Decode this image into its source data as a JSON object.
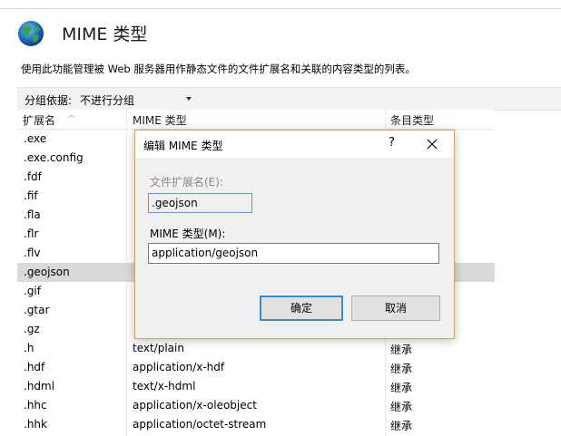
{
  "header": {
    "title": "MIME 类型",
    "description": "使用此功能管理被 Web 服务器用作静态文件的文件扩展名和关联的内容类型的列表。"
  },
  "group_bar": {
    "label": "分组依据:",
    "selected": "不进行分组"
  },
  "table": {
    "columns": [
      "扩展名",
      "MIME 类型",
      "条目类型"
    ],
    "rows": [
      {
        "ext": ".exe",
        "mime": "",
        "type": ""
      },
      {
        "ext": ".exe.config",
        "mime": "",
        "type": ""
      },
      {
        "ext": ".fdf",
        "mime": "",
        "type": ""
      },
      {
        "ext": ".fif",
        "mime": "",
        "type": ""
      },
      {
        "ext": ".fla",
        "mime": "",
        "type": ""
      },
      {
        "ext": ".flr",
        "mime": "",
        "type": ""
      },
      {
        "ext": ".flv",
        "mime": "",
        "type": ""
      },
      {
        "ext": ".geojson",
        "mime": "",
        "type": ""
      },
      {
        "ext": ".gif",
        "mime": "",
        "type": ""
      },
      {
        "ext": ".gtar",
        "mime": "",
        "type": ""
      },
      {
        "ext": ".gz",
        "mime": "",
        "type": ""
      },
      {
        "ext": ".h",
        "mime": "text/plain",
        "type": "继承"
      },
      {
        "ext": ".hdf",
        "mime": "application/x-hdf",
        "type": "继承"
      },
      {
        "ext": ".hdml",
        "mime": "text/x-hdml",
        "type": "继承"
      },
      {
        "ext": ".hhc",
        "mime": "application/x-oleobject",
        "type": "继承"
      },
      {
        "ext": ".hhk",
        "mime": "application/octet-stream",
        "type": "继承"
      }
    ]
  },
  "dialog": {
    "title": "编辑 MIME 类型",
    "help": "?",
    "ext_label": "文件扩展名(E):",
    "ext_value": ".geojson",
    "mime_label": "MIME 类型(M):",
    "mime_value": "application/geojson",
    "ok_label": "确定",
    "cancel_label": "取消"
  },
  "colors": {
    "selected_row": "#d9d9d9",
    "dialog_border": "#c9a46a",
    "focus_blue": "#3c8ad0"
  }
}
